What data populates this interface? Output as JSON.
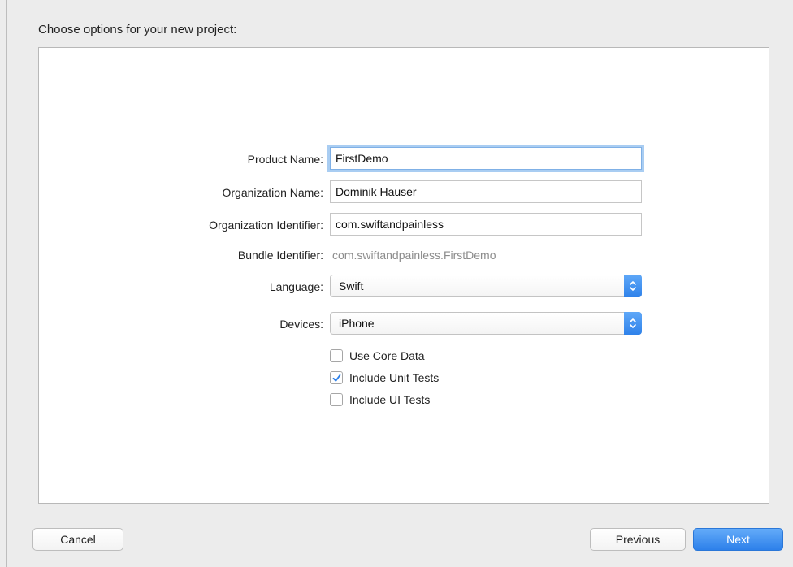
{
  "dialog": {
    "title": "Choose options for your new project:"
  },
  "form": {
    "product_name": {
      "label": "Product Name:",
      "value": "FirstDemo"
    },
    "organization_name": {
      "label": "Organization Name:",
      "value": "Dominik Hauser"
    },
    "organization_identifier": {
      "label": "Organization Identifier:",
      "value": "com.swiftandpainless"
    },
    "bundle_identifier": {
      "label": "Bundle Identifier:",
      "value": "com.swiftandpainless.FirstDemo"
    },
    "language": {
      "label": "Language:",
      "selected": "Swift"
    },
    "devices": {
      "label": "Devices:",
      "selected": "iPhone"
    },
    "options": [
      {
        "label": "Use Core Data",
        "checked": false
      },
      {
        "label": "Include Unit Tests",
        "checked": true
      },
      {
        "label": "Include UI Tests",
        "checked": false
      }
    ]
  },
  "footer": {
    "cancel_label": "Cancel",
    "previous_label": "Previous",
    "next_label": "Next"
  },
  "colors": {
    "accent": "#2d80ea",
    "focus_ring": "#a9cdf2",
    "background": "#ececec"
  },
  "icons": {
    "select_arrow": "chevron-up-down-icon",
    "checkmark": "checkmark-icon"
  }
}
